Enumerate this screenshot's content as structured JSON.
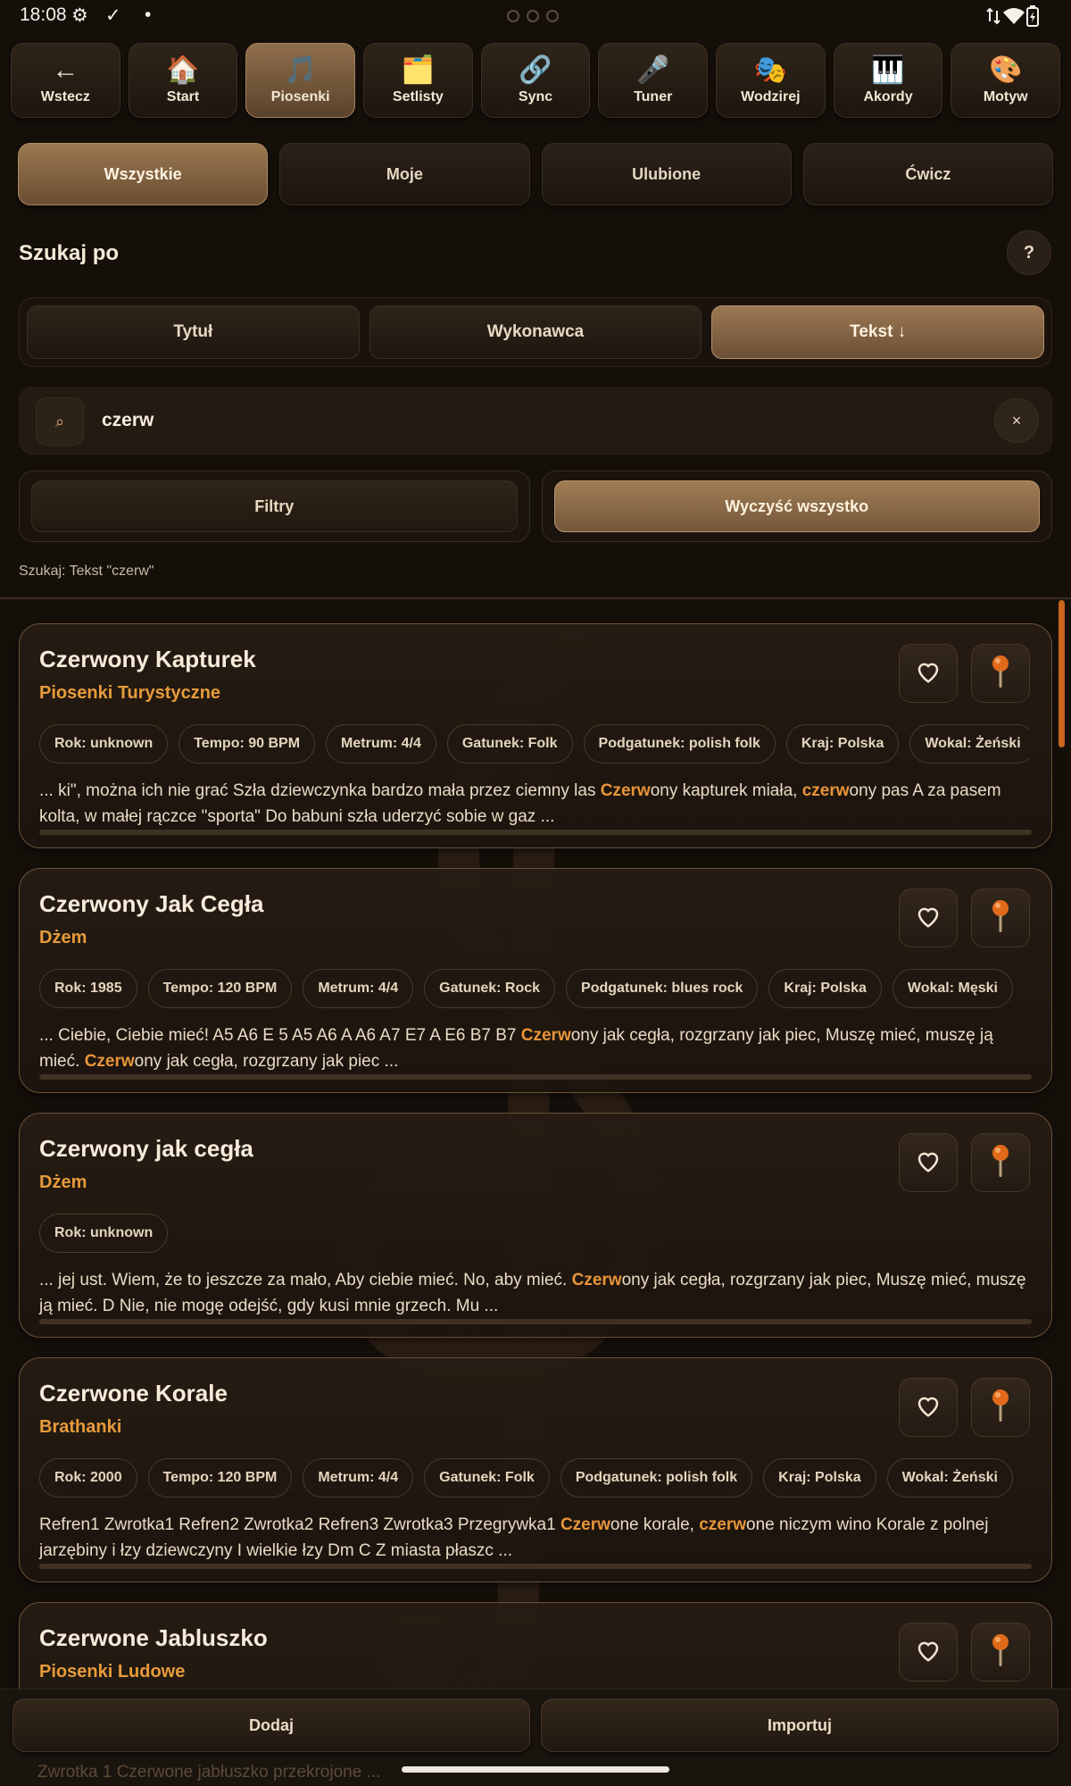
{
  "status_bar": {
    "time": "18:08"
  },
  "top_nav": [
    {
      "icon": "←",
      "label": "Wstecz",
      "active": false
    },
    {
      "icon": "🏠",
      "label": "Start",
      "active": false
    },
    {
      "icon": "🎵",
      "label": "Piosenki",
      "active": true
    },
    {
      "icon": "🗂️",
      "label": "Setlisty",
      "active": false
    },
    {
      "icon": "🔗",
      "label": "Sync",
      "active": false
    },
    {
      "icon": "🎤",
      "label": "Tuner",
      "active": false
    },
    {
      "icon": "🎭",
      "label": "Wodzirej",
      "active": false
    },
    {
      "icon": "🎹",
      "label": "Akordy",
      "active": false
    },
    {
      "icon": "🎨",
      "label": "Motyw",
      "active": false
    }
  ],
  "filter_tabs": [
    {
      "label": "Wszystkie",
      "active": true
    },
    {
      "label": "Moje",
      "active": false
    },
    {
      "label": "Ulubione",
      "active": false
    },
    {
      "label": "Ćwicz",
      "active": false
    }
  ],
  "search_by": {
    "title": "Szukaj po",
    "help": "?",
    "options": [
      {
        "label": "Tytuł",
        "active": false
      },
      {
        "label": "Wykonawca",
        "active": false
      },
      {
        "label": "Tekst ↓",
        "active": true
      }
    ]
  },
  "search": {
    "icon": "⌕",
    "value": "czerw",
    "clear": "×"
  },
  "actions": {
    "filters": "Filtry",
    "clear_all": "Wyczyść wszystko"
  },
  "summary": "Szukaj: Tekst \"czerw\"",
  "songs": [
    {
      "title": "Czerwony Kapturek",
      "artist": "Piosenki Turystyczne",
      "chips": [
        "Rok: unknown",
        "Tempo: 90 BPM",
        "Metrum: 4/4",
        "Gatunek: Folk",
        "Podgatunek: polish folk",
        "Kraj: Polska",
        "Wokal: Żeński"
      ],
      "snippet": [
        {
          "t": "... ki\", można ich nie grać Szła dziewczynka bardzo mała przez ciemny las ",
          "h": false
        },
        {
          "t": "Czerw",
          "h": true
        },
        {
          "t": "ony kapturek miała, ",
          "h": false
        },
        {
          "t": "czerw",
          "h": true
        },
        {
          "t": "ony pas A za pasem kolta, w małej rączce \"sporta\" Do babuni szła uderzyć sobie w gaz ...",
          "h": false
        }
      ]
    },
    {
      "title": "Czerwony Jak Cegła",
      "artist": "Dżem",
      "chips": [
        "Rok: 1985",
        "Tempo: 120 BPM",
        "Metrum: 4/4",
        "Gatunek: Rock",
        "Podgatunek: blues rock",
        "Kraj: Polska",
        "Wokal: Męski"
      ],
      "snippet": [
        {
          "t": "... Ciebie, Ciebie mieć! A5 A6 E 5 A5 A6 A A6 A7 E7 A E6 B7 B7 ",
          "h": false
        },
        {
          "t": "Czerw",
          "h": true
        },
        {
          "t": "ony jak cegła, rozgrzany jak piec, Muszę mieć, muszę ją mieć. ",
          "h": false
        },
        {
          "t": "Czerw",
          "h": true
        },
        {
          "t": "ony jak cegła, rozgrzany jak piec ...",
          "h": false
        }
      ]
    },
    {
      "title": "Czerwony jak cegła",
      "artist": "Dżem",
      "chips": [
        "Rok: unknown"
      ],
      "snippet": [
        {
          "t": "... jej ust. Wiem, że to jeszcze za mało, Aby ciebie mieć. No, aby mieć. ",
          "h": false
        },
        {
          "t": "Czerw",
          "h": true
        },
        {
          "t": "ony jak cegła, rozgrzany jak piec, Muszę mieć, muszę ją mieć. D Nie, nie mogę odejść, gdy kusi mnie grzech. Mu ...",
          "h": false
        }
      ]
    },
    {
      "title": "Czerwone Korale",
      "artist": "Brathanki",
      "chips": [
        "Rok: 2000",
        "Tempo: 120 BPM",
        "Metrum: 4/4",
        "Gatunek: Folk",
        "Podgatunek: polish folk",
        "Kraj: Polska",
        "Wokal: Żeński"
      ],
      "snippet": [
        {
          "t": "Refren1 Zwrotka1 Refren2 Zwrotka2 Refren3 Zwrotka3 Przegrywka1 ",
          "h": false
        },
        {
          "t": "Czerw",
          "h": true
        },
        {
          "t": "one korale, ",
          "h": false
        },
        {
          "t": "czerw",
          "h": true
        },
        {
          "t": "one niczym wino Korale z polnej jarzębiny i łzy dziewczyny I wielkie łzy Dm C Z miasta płaszc ...",
          "h": false
        }
      ]
    },
    {
      "title": "Czerwone Jabluszko",
      "artist": "Piosenki Ludowe",
      "chips": [],
      "snippet": []
    }
  ],
  "bottom": {
    "add": "Dodaj",
    "import": "Importuj",
    "peek_text": "Zwrotka 1 Czerwone jabłuszko przekrojone ..."
  },
  "colors": {
    "accent": "#e8953a",
    "background": "#150f0a",
    "active_button": "#8f6e4b",
    "pin": "#e06a1a"
  }
}
